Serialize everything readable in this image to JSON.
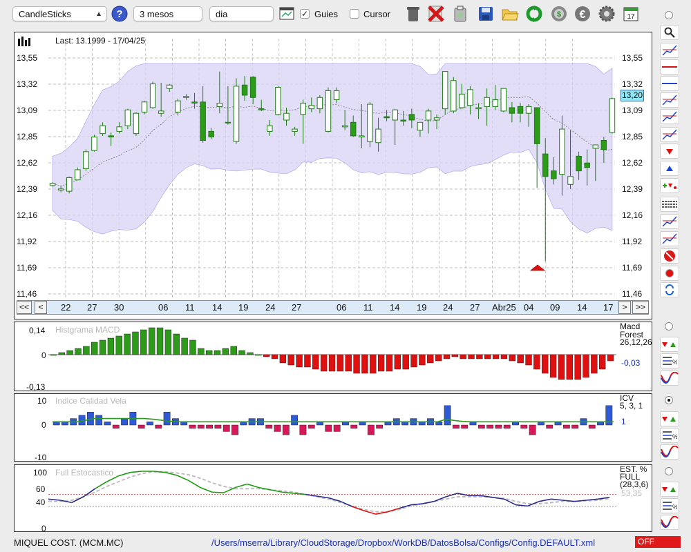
{
  "toolbar": {
    "chart_type": "CandleSticks",
    "period": "3 mesos",
    "interval": "dia",
    "guides_label": "Guies",
    "guides_checked": true,
    "cursor_label": "Cursor",
    "cursor_checked": false,
    "icons": [
      "help-icon",
      "calculator-icon",
      "trash-icon",
      "delete-icon",
      "clipboard-icon",
      "save-icon",
      "open-folder-icon",
      "refresh-icon",
      "update-icon",
      "euro-icon",
      "settings-icon",
      "calendar-icon"
    ],
    "calendar_day": "17"
  },
  "main_chart": {
    "last_label": "Last: 13.1999 - 17/04/25",
    "y_ticks": [
      "13,55",
      "13,32",
      "13,09",
      "12,85",
      "12,62",
      "12,39",
      "12,16",
      "11,92",
      "11,69",
      "11,46"
    ],
    "current_value": "13,20",
    "x_labels": [
      "22",
      "27",
      "30",
      "06",
      "11",
      "14",
      "19",
      "24",
      "27",
      "06",
      "11",
      "14",
      "19",
      "24",
      "27",
      "Abr25",
      "04",
      "09",
      "14",
      "17"
    ],
    "nav": {
      "first": "<<",
      "prev": "<",
      "next": ">",
      "last": ">>"
    }
  },
  "macd_panel": {
    "title": "Histgrama MACD",
    "y_ticks": [
      "0,14",
      "0",
      "-0,13"
    ],
    "name": "Macd",
    "name2": "Forest",
    "params": "26,12,26",
    "value": "-0,03"
  },
  "icv_panel": {
    "title": "Indice Calidad Vela",
    "y_ticks": [
      "10",
      "0",
      "-10"
    ],
    "name": "ICV",
    "params": "5, 3, 1",
    "value": "1"
  },
  "stoch_panel": {
    "title": "Full Estocastico",
    "y_ticks": [
      "100",
      "60",
      "40",
      "0"
    ],
    "name": "EST. %",
    "name2": "FULL",
    "params": "(28,3,6)",
    "value": "53,35"
  },
  "status": {
    "ticker": "MIQUEL COST. (MCM.MC)",
    "path": "/Users/mserra/Library/CloudStorage/Dropbox/WorkDB/DatosBolsa/Configs/Config.DEFAULT.xml",
    "mode": "OFF"
  },
  "colors": {
    "up": "#2e9a1a",
    "down": "#2e9a1a",
    "band": "#d9d3f5",
    "neg": "#e01010",
    "blue": "#2244cc",
    "pink": "#d8185a"
  },
  "chart_data": {
    "type": "candlestick",
    "candles": [
      [
        12.42,
        12.45,
        12.41,
        12.44
      ],
      [
        12.38,
        12.42,
        12.36,
        12.39
      ],
      [
        12.37,
        12.5,
        12.35,
        12.49
      ],
      [
        12.47,
        12.58,
        12.47,
        12.56
      ],
      [
        12.57,
        12.74,
        12.55,
        12.72
      ],
      [
        12.73,
        12.87,
        12.72,
        12.85
      ],
      [
        12.88,
        12.98,
        12.86,
        12.95
      ],
      [
        12.86,
        12.89,
        12.77,
        12.85
      ],
      [
        12.9,
        12.98,
        12.88,
        12.94
      ],
      [
        12.95,
        13.1,
        12.92,
        13.09
      ],
      [
        12.88,
        13.07,
        12.86,
        13.06
      ],
      [
        13.07,
        13.17,
        13.05,
        13.16
      ],
      [
        13.11,
        13.34,
        13.1,
        13.32
      ],
      [
        13.06,
        13.33,
        13.03,
        13.08
      ],
      [
        13.28,
        13.32,
        13.25,
        13.31
      ],
      [
        13.07,
        13.19,
        13.04,
        13.17
      ],
      [
        13.2,
        13.23,
        13.18,
        13.21
      ],
      [
        13.16,
        13.24,
        13.1,
        13.15
      ],
      [
        13.16,
        13.3,
        12.8,
        12.82
      ],
      [
        12.9,
        12.93,
        12.83,
        12.85
      ],
      [
        13.12,
        13.43,
        13.06,
        13.15
      ],
      [
        12.98,
        13.3,
        12.96,
        12.98
      ],
      [
        12.81,
        13.37,
        12.79,
        13.3
      ],
      [
        13.31,
        13.39,
        13.17,
        13.22
      ],
      [
        13.38,
        13.39,
        13.14,
        13.2
      ],
      [
        13.1,
        13.18,
        13.08,
        13.09
      ],
      [
        12.9,
        13.0,
        12.86,
        12.95
      ],
      [
        13.05,
        13.3,
        13.04,
        13.29
      ],
      [
        13.0,
        13.11,
        12.95,
        13.06
      ],
      [
        12.9,
        12.94,
        12.86,
        12.92
      ],
      [
        13.05,
        13.18,
        12.79,
        13.15
      ],
      [
        13.1,
        13.2,
        13.07,
        13.13
      ],
      [
        13.1,
        13.22,
        13.06,
        13.2
      ],
      [
        12.9,
        13.29,
        12.89,
        13.26
      ],
      [
        13.18,
        13.29,
        13.15,
        13.26
      ],
      [
        12.94,
        13.09,
        12.91,
        12.95
      ],
      [
        12.98,
        13.04,
        12.85,
        12.86
      ],
      [
        12.85,
        13.14,
        12.75,
        12.86
      ],
      [
        12.81,
        13.16,
        12.76,
        13.14
      ],
      [
        12.8,
        13.02,
        12.72,
        12.92
      ],
      [
        13.03,
        13.09,
        12.99,
        13.02
      ],
      [
        13.0,
        13.1,
        12.78,
        13.09
      ],
      [
        13.0,
        13.08,
        12.95,
        12.99
      ],
      [
        13.05,
        13.1,
        12.93,
        13.0
      ],
      [
        12.91,
        12.97,
        12.85,
        12.98
      ],
      [
        13.0,
        13.1,
        12.88,
        13.08
      ],
      [
        13.0,
        13.05,
        12.92,
        13.02
      ],
      [
        13.1,
        13.43,
        13.05,
        13.43
      ],
      [
        13.08,
        13.38,
        13.06,
        13.35
      ],
      [
        13.11,
        13.32,
        13.1,
        13.23
      ],
      [
        13.13,
        13.3,
        13.05,
        13.27
      ],
      [
        13.1,
        13.15,
        13.01,
        13.11
      ],
      [
        13.12,
        13.28,
        12.95,
        13.2
      ],
      [
        13.12,
        13.31,
        13.09,
        13.18
      ],
      [
        13.08,
        13.26,
        13.07,
        13.28
      ],
      [
        13.11,
        13.16,
        12.98,
        13.06
      ],
      [
        13.12,
        13.15,
        12.98,
        13.06
      ],
      [
        13.06,
        13.14,
        12.94,
        13.12
      ],
      [
        13.11,
        13.11,
        12.4,
        12.79
      ],
      [
        12.7,
        12.84,
        11.75,
        12.5
      ],
      [
        12.55,
        12.67,
        12.43,
        12.48
      ],
      [
        12.52,
        13.04,
        12.33,
        12.92
      ],
      [
        12.43,
        12.91,
        12.39,
        12.5
      ],
      [
        12.68,
        12.72,
        12.47,
        12.55
      ],
      [
        12.62,
        12.74,
        12.42,
        12.58
      ],
      [
        12.75,
        12.77,
        12.46,
        12.78
      ],
      [
        12.82,
        12.85,
        12.62,
        12.74
      ],
      [
        12.89,
        13.2,
        12.88,
        13.19
      ]
    ],
    "ylim": [
      11.46,
      13.55
    ],
    "macd_histogram": [
      0.0,
      0.01,
      0.02,
      0.03,
      0.04,
      0.06,
      0.07,
      0.08,
      0.09,
      0.1,
      0.11,
      0.12,
      0.13,
      0.13,
      0.12,
      0.1,
      0.08,
      0.07,
      0.03,
      0.02,
      0.02,
      0.03,
      0.04,
      0.02,
      0.01,
      0.0,
      -0.01,
      -0.02,
      -0.04,
      -0.05,
      -0.06,
      -0.06,
      -0.07,
      -0.08,
      -0.08,
      -0.08,
      -0.08,
      -0.09,
      -0.09,
      -0.09,
      -0.08,
      -0.08,
      -0.07,
      -0.07,
      -0.06,
      -0.05,
      -0.04,
      -0.03,
      -0.02,
      -0.01,
      -0.02,
      -0.02,
      -0.02,
      -0.02,
      -0.02,
      -0.02,
      -0.03,
      -0.04,
      -0.05,
      -0.07,
      -0.09,
      -0.11,
      -0.12,
      -0.12,
      -0.12,
      -0.11,
      -0.09,
      -0.07,
      -0.03
    ],
    "icv": [
      1,
      1,
      2,
      3,
      4,
      3,
      1,
      -1,
      2,
      4,
      -1,
      1,
      -1,
      4,
      2,
      1,
      -1,
      -1,
      -1,
      -1,
      -2,
      -3,
      1,
      2,
      2,
      -1,
      -2,
      -3,
      3,
      -3,
      -1,
      1,
      -2,
      -2,
      1,
      -1,
      1,
      -3,
      -1,
      1,
      2,
      1,
      2,
      1,
      2,
      1,
      6,
      -1,
      -1,
      1,
      -1,
      -1,
      -1,
      -1,
      1,
      -1,
      -3,
      1,
      -1,
      1,
      -1,
      -1,
      2,
      -1,
      1,
      6
    ],
    "icv_ma": [
      1,
      1,
      1,
      1,
      1.5,
      2,
      2,
      2,
      2,
      2,
      2,
      2,
      1.8,
      1.5,
      1.2,
      1,
      1,
      1,
      1,
      1,
      1,
      1,
      1,
      1,
      1,
      1,
      1,
      1,
      1,
      1,
      1,
      1,
      1,
      1,
      1,
      1,
      1,
      1,
      1,
      1,
      1,
      1,
      1,
      1,
      1,
      1,
      1,
      1.8,
      1.4,
      1.1,
      1,
      1,
      1,
      1,
      1,
      1,
      1,
      1,
      1,
      1,
      1,
      1,
      1,
      1,
      1,
      1,
      1,
      1
    ],
    "stoch_k": [
      52,
      50,
      46,
      56,
      70,
      82,
      92,
      98,
      100,
      100,
      98,
      93,
      84,
      72,
      64,
      63,
      72,
      78,
      72,
      68,
      64,
      62,
      60,
      57,
      54,
      48,
      39,
      32,
      26,
      30,
      36,
      42,
      44,
      48,
      56,
      62,
      58,
      58,
      55,
      52,
      42,
      40,
      48,
      52,
      50,
      48,
      50,
      52,
      55
    ],
    "stoch_d": [
      48,
      48,
      50,
      56,
      64,
      74,
      82,
      90,
      96,
      99,
      99,
      97,
      94,
      88,
      80,
      74,
      70,
      70,
      70,
      68,
      66,
      64,
      60,
      56,
      52,
      46,
      40,
      34,
      30,
      30,
      34,
      40,
      44,
      48,
      52,
      56,
      56,
      56,
      55,
      53,
      48,
      44,
      44,
      46,
      48,
      48,
      49,
      50,
      53
    ],
    "stoch_levels": [
      40,
      60
    ]
  }
}
